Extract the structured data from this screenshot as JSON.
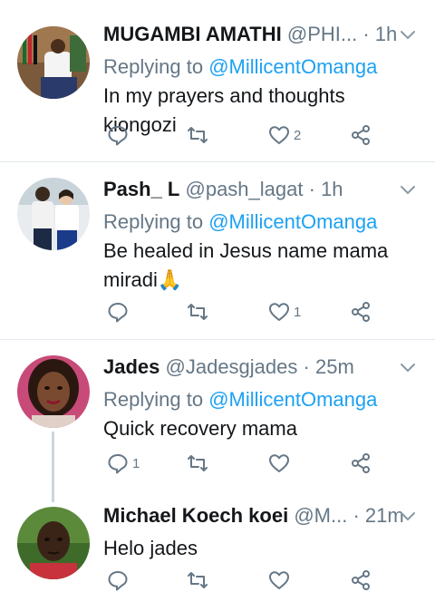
{
  "tweets": [
    {
      "name": "MUGAMBI AMATHI",
      "handle": "@PHI...",
      "time": "1h",
      "replying_label": "Replying to",
      "replying_to": "@MillicentOmanga",
      "text": "In my prayers and thoughts kiongozi",
      "reply_count": "",
      "retweet_count": "",
      "like_count": "2"
    },
    {
      "name": "Pash_ L",
      "handle": "@pash_lagat",
      "time": "1h",
      "replying_label": "Replying to",
      "replying_to": "@MillicentOmanga",
      "text_line1": "Be healed in Jesus name mama",
      "text_line2": "miradi🙏",
      "reply_count": "",
      "retweet_count": "",
      "like_count": "1"
    },
    {
      "name": "Jades",
      "handle": "@Jadesgjades",
      "time": "25m",
      "replying_label": "Replying to",
      "replying_to": "@MillicentOmanga",
      "text": "Quick recovery mama",
      "reply_count": "1",
      "retweet_count": "",
      "like_count": ""
    },
    {
      "name": "Michael Koech koei",
      "handle": "@M...",
      "time": "21m",
      "text": "Helo jades",
      "reply_count": "",
      "retweet_count": "",
      "like_count": ""
    }
  ],
  "separator": "·",
  "colors": {
    "accent": "#1da1f2",
    "secondary_text": "#657786",
    "divider": "#e1e8ed"
  }
}
